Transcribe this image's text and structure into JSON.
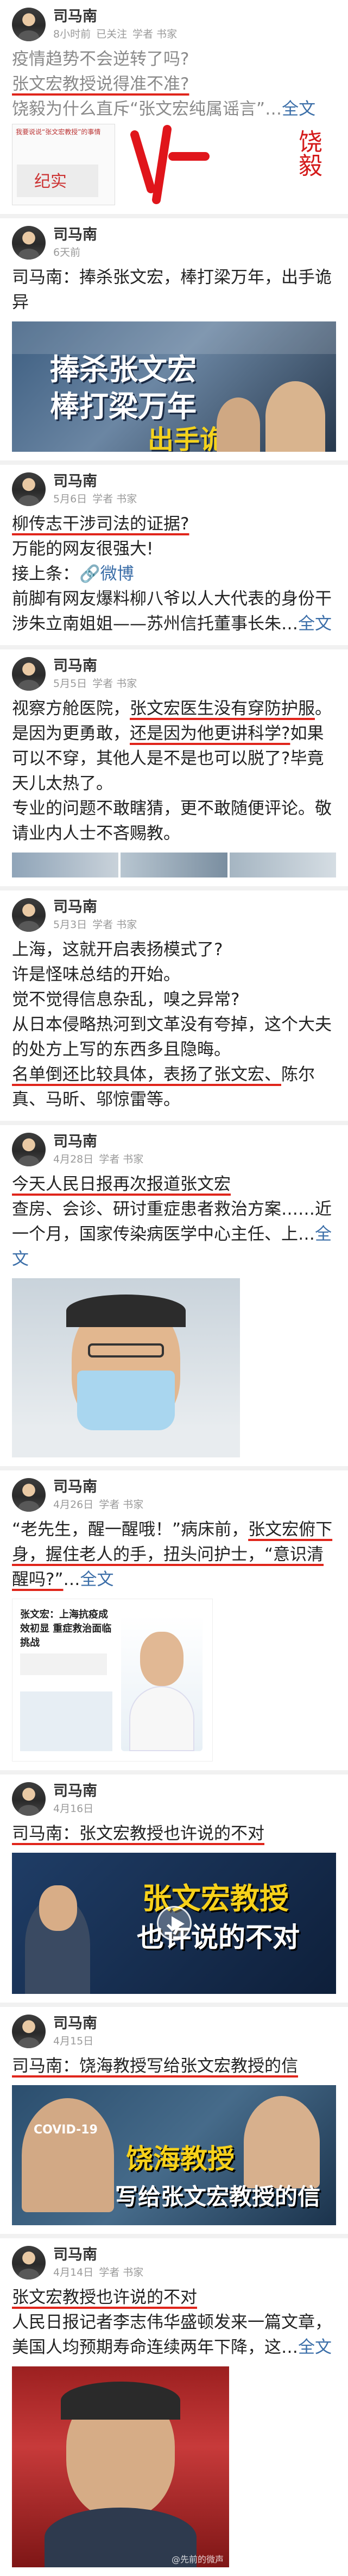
{
  "posts": [
    {
      "author": "司马南",
      "time": "8小时前",
      "follow": "已关注",
      "role": "学者 书家",
      "lines": [
        "疫情趋势不会逆转了吗?",
        "张文宏教授说得准不准?",
        "饶毅为什么直斥“张文宏纯属谣言”…"
      ],
      "more": "全文",
      "img_small_text": "我要说说“张文宏教授”的事情",
      "img_stamp": "纪实",
      "img_cursive": "饶毅"
    },
    {
      "author": "司马南",
      "time": "6天前",
      "lines": [
        "司马南：捧杀张文宏，棒打梁万年，出手诡异"
      ],
      "banner": [
        "捧杀张文宏",
        "棒打梁万年",
        "出手诡异"
      ]
    },
    {
      "author": "司马南",
      "time": "5月6日",
      "role": "学者 书家",
      "lines": [
        "柳传志干涉司法的证据?",
        "万能的网友很强大!",
        "接上条：",
        "微博",
        "前脚有网友爆料柳八爷以人大代表的身份干涉朱立南姐姐——苏州信托董事长朱…"
      ],
      "more": "全文"
    },
    {
      "author": "司马南",
      "time": "5月5日",
      "role": "学者 书家",
      "lines": [
        "视察方舱医院，",
        "张文宏医生没有穿防护服",
        "。是因为更勇敢，",
        "还是因为他更讲科学?",
        "如果可以不穿，其他人是不是也可以脱了?毕竟天儿太热了。",
        "专业的问题不敢瞎猜，更不敢随便评论。敬请业内人士不吝赐教。"
      ]
    },
    {
      "author": "司马南",
      "time": "5月3日",
      "role": "学者 书家",
      "lines": [
        "上海，这就开启表扬模式了?",
        "许是怪味总结的开始。",
        "觉不觉得信息杂乱，嗅之异常?",
        "从日本侵略热河到文革没有夸掉，这个大夫的处方上写的东西多且隐晦。",
        "名单倒还比较具体，表扬了张文宏、",
        "陈尔真、马昕、邬惊雷等。"
      ]
    },
    {
      "author": "司马南",
      "time": "4月28日",
      "role": "学者 书家",
      "lines": [
        "今天人民日报再次报道张文宏",
        "查房、会诊、研讨重症患者救治方案……近一个月，国家传染病医学中心主任、上…"
      ],
      "more": "全文"
    },
    {
      "author": "司马南",
      "time": "4月26日",
      "role": "学者 书家",
      "lines": [
        "“老先生，醒一醒哦！”病床前，",
        "张文宏俯下身，握住老人的手，扭头问护士，",
        "“意识清醒吗?”",
        "…"
      ],
      "more": "全文",
      "card_title": "张文宏：上海抗疫成效初显 重症救治面临挑战"
    },
    {
      "author": "司马南",
      "time": "4月16日",
      "lines": [
        "司马南：张文宏教授也许说的不对"
      ],
      "banner": [
        "张文宏教授",
        "也许说的不对"
      ]
    },
    {
      "author": "司马南",
      "time": "4月15日",
      "lines": [
        "司马南：饶海教授写给张文宏教授的信"
      ],
      "banner": [
        "饶海教授",
        "写给张文宏教授的信"
      ],
      "covid": "COVID-19"
    },
    {
      "author": "司马南",
      "time": "4月14日",
      "role": "学者 书家",
      "lines": [
        "张文宏教授也许说的不对",
        "人民日报记者李志伟华盛顿发来一篇文章，美国人均预期寿命连续两年下降，这…"
      ],
      "more": "全文",
      "watermark": "@先前的微声"
    }
  ]
}
